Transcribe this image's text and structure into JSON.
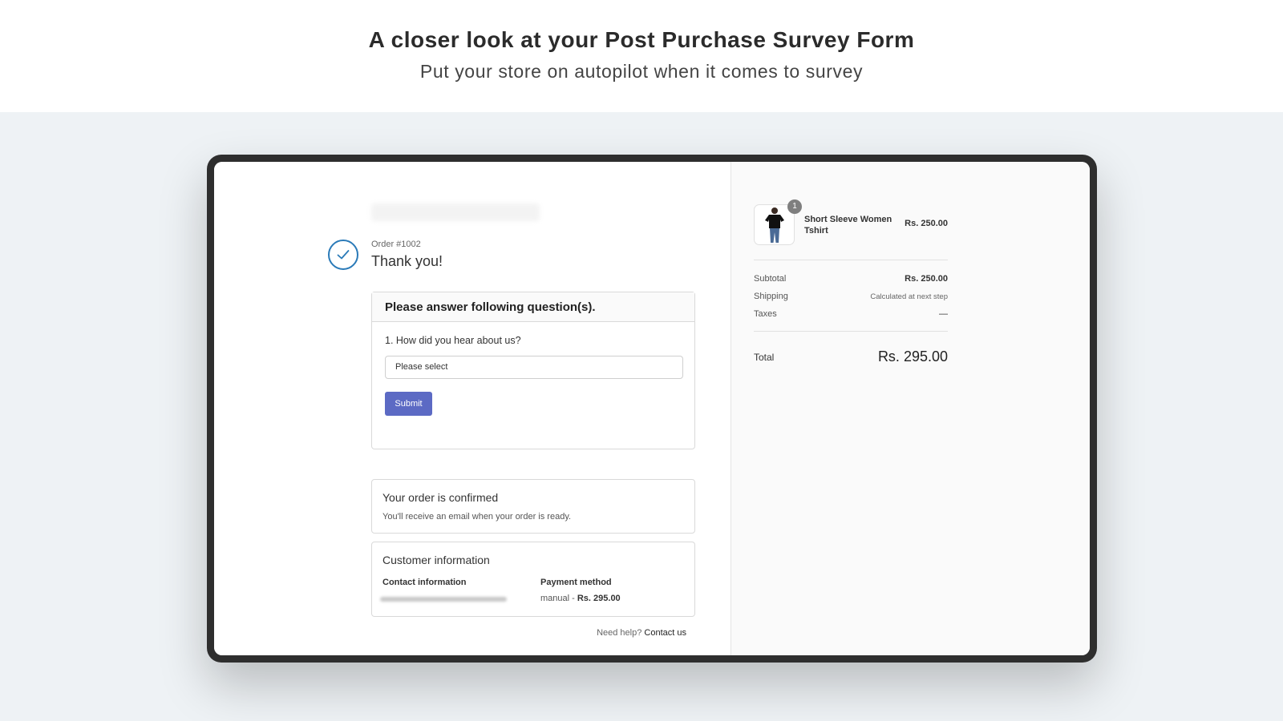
{
  "hero": {
    "title": "A closer look at your Post Purchase Survey Form",
    "subtitle": "Put your store on autopilot when it comes to survey"
  },
  "order": {
    "number": "Order #1002",
    "thank_you": "Thank you!"
  },
  "survey": {
    "heading": "Please answer following question(s).",
    "question": "1. How did you hear about us?",
    "select_value": "Please select",
    "submit_label": "Submit"
  },
  "confirmation": {
    "title": "Your order is confirmed",
    "text": "You'll receive an email when your order is ready."
  },
  "customer": {
    "title": "Customer information",
    "contact_heading": "Contact information",
    "payment_heading": "Payment method",
    "payment_method": "manual - ",
    "payment_amount": "Rs. 295.00"
  },
  "help": {
    "text": "Need help? ",
    "link": "Contact us"
  },
  "cart": {
    "item": {
      "quantity": "1",
      "name": "Short Sleeve Women Tshirt",
      "price": "Rs. 250.00"
    },
    "subtotal_label": "Subtotal",
    "subtotal_value": "Rs. 250.00",
    "shipping_label": "Shipping",
    "shipping_value": "Calculated at next step",
    "taxes_label": "Taxes",
    "taxes_value": "—",
    "total_label": "Total",
    "total_value": "Rs. 295.00"
  },
  "colors": {
    "accent": "#5c6ac4",
    "check": "#2a7ab8",
    "device_frame": "#2e2e2e",
    "stage_bg": "#eef2f5"
  },
  "icons": [
    "checkmark-circle-icon",
    "tshirt-product-image"
  ]
}
